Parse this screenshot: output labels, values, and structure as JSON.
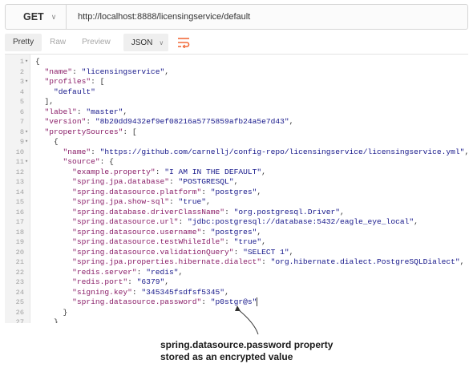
{
  "request": {
    "method": "GET",
    "url": "http://localhost:8888/licensingservice/default"
  },
  "toolbar": {
    "tabs": [
      "Pretty",
      "Raw",
      "Preview"
    ],
    "format": "JSON"
  },
  "code_lines": [
    [
      [
        "p",
        "{"
      ]
    ],
    [
      [
        "p",
        "  "
      ],
      [
        "key",
        "\"name\""
      ],
      [
        "p",
        ": "
      ],
      [
        "str",
        "\"licensingservice\""
      ],
      [
        "p",
        ","
      ]
    ],
    [
      [
        "p",
        "  "
      ],
      [
        "key",
        "\"profiles\""
      ],
      [
        "p",
        ": ["
      ]
    ],
    [
      [
        "p",
        "    "
      ],
      [
        "str",
        "\"default\""
      ]
    ],
    [
      [
        "p",
        "  ],"
      ]
    ],
    [
      [
        "p",
        "  "
      ],
      [
        "key",
        "\"label\""
      ],
      [
        "p",
        ": "
      ],
      [
        "str",
        "\"master\""
      ],
      [
        "p",
        ","
      ]
    ],
    [
      [
        "p",
        "  "
      ],
      [
        "key",
        "\"version\""
      ],
      [
        "p",
        ": "
      ],
      [
        "str",
        "\"8b20dd9432ef9ef08216a5775859afb24a5e7d43\""
      ],
      [
        "p",
        ","
      ]
    ],
    [
      [
        "p",
        "  "
      ],
      [
        "key",
        "\"propertySources\""
      ],
      [
        "p",
        ": ["
      ]
    ],
    [
      [
        "p",
        "    {"
      ]
    ],
    [
      [
        "p",
        "      "
      ],
      [
        "key",
        "\"name\""
      ],
      [
        "p",
        ": "
      ],
      [
        "str",
        "\"https://github.com/carnellj/config-repo/licensingservice/licensingservice.yml\""
      ],
      [
        "p",
        ","
      ]
    ],
    [
      [
        "p",
        "      "
      ],
      [
        "key",
        "\"source\""
      ],
      [
        "p",
        ": {"
      ]
    ],
    [
      [
        "p",
        "        "
      ],
      [
        "key",
        "\"example.property\""
      ],
      [
        "p",
        ": "
      ],
      [
        "str",
        "\"I AM IN THE DEFAULT\""
      ],
      [
        "p",
        ","
      ]
    ],
    [
      [
        "p",
        "        "
      ],
      [
        "key",
        "\"spring.jpa.database\""
      ],
      [
        "p",
        ": "
      ],
      [
        "str",
        "\"POSTGRESQL\""
      ],
      [
        "p",
        ","
      ]
    ],
    [
      [
        "p",
        "        "
      ],
      [
        "key",
        "\"spring.datasource.platform\""
      ],
      [
        "p",
        ": "
      ],
      [
        "str",
        "\"postgres\""
      ],
      [
        "p",
        ","
      ]
    ],
    [
      [
        "p",
        "        "
      ],
      [
        "key",
        "\"spring.jpa.show-sql\""
      ],
      [
        "p",
        ": "
      ],
      [
        "str",
        "\"true\""
      ],
      [
        "p",
        ","
      ]
    ],
    [
      [
        "p",
        "        "
      ],
      [
        "key",
        "\"spring.database.driverClassName\""
      ],
      [
        "p",
        ": "
      ],
      [
        "str",
        "\"org.postgresql.Driver\""
      ],
      [
        "p",
        ","
      ]
    ],
    [
      [
        "p",
        "        "
      ],
      [
        "key",
        "\"spring.datasource.url\""
      ],
      [
        "p",
        ": "
      ],
      [
        "str",
        "\"jdbc:postgresql://database:5432/eagle_eye_local\""
      ],
      [
        "p",
        ","
      ]
    ],
    [
      [
        "p",
        "        "
      ],
      [
        "key",
        "\"spring.datasource.username\""
      ],
      [
        "p",
        ": "
      ],
      [
        "str",
        "\"postgres\""
      ],
      [
        "p",
        ","
      ]
    ],
    [
      [
        "p",
        "        "
      ],
      [
        "key",
        "\"spring.datasource.testWhileIdle\""
      ],
      [
        "p",
        ": "
      ],
      [
        "str",
        "\"true\""
      ],
      [
        "p",
        ","
      ]
    ],
    [
      [
        "p",
        "        "
      ],
      [
        "key",
        "\"spring.datasource.validationQuery\""
      ],
      [
        "p",
        ": "
      ],
      [
        "str",
        "\"SELECT 1\""
      ],
      [
        "p",
        ","
      ]
    ],
    [
      [
        "p",
        "        "
      ],
      [
        "key",
        "\"spring.jpa.properties.hibernate.dialect\""
      ],
      [
        "p",
        ": "
      ],
      [
        "str",
        "\"org.hibernate.dialect.PostgreSQLDialect\""
      ],
      [
        "p",
        ","
      ]
    ],
    [
      [
        "p",
        "        "
      ],
      [
        "key",
        "\"redis.server\""
      ],
      [
        "p",
        ": "
      ],
      [
        "str",
        "\"redis\""
      ],
      [
        "p",
        ","
      ]
    ],
    [
      [
        "p",
        "        "
      ],
      [
        "key",
        "\"redis.port\""
      ],
      [
        "p",
        ": "
      ],
      [
        "str",
        "\"6379\""
      ],
      [
        "p",
        ","
      ]
    ],
    [
      [
        "p",
        "        "
      ],
      [
        "key",
        "\"signing.key\""
      ],
      [
        "p",
        ": "
      ],
      [
        "str",
        "\"345345fsdfsf5345\""
      ],
      [
        "p",
        ","
      ]
    ],
    [
      [
        "p",
        "        "
      ],
      [
        "key",
        "\"spring.datasource.password\""
      ],
      [
        "p",
        ": "
      ],
      [
        "str",
        "\"p0stgr@s\""
      ]
    ],
    [
      [
        "p",
        "      }"
      ]
    ],
    [
      [
        "p",
        "    }"
      ]
    ]
  ],
  "line_numbers": [
    "1",
    "2",
    "3",
    "4",
    "5",
    "6",
    "7",
    "8",
    "9",
    "10",
    "11",
    "12",
    "13",
    "14",
    "15",
    "16",
    "17",
    "18",
    "19",
    "20",
    "21",
    "22",
    "23",
    "24",
    "25",
    "26",
    "27"
  ],
  "folds": [
    "1",
    "3",
    "8",
    "9",
    "11"
  ],
  "annotation": {
    "line1": "spring.datasource.password property",
    "line2": "stored as an encrypted value"
  }
}
